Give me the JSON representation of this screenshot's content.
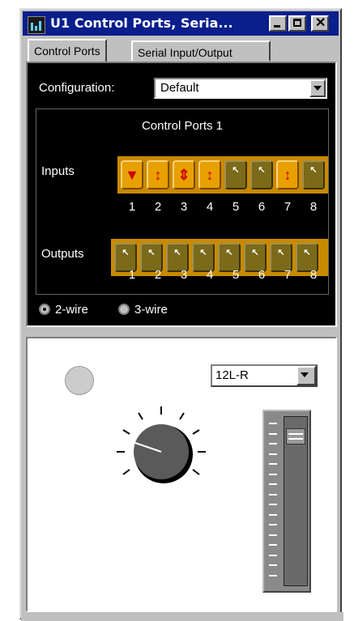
{
  "window": {
    "title": "U1 Control Ports, Seria...",
    "icon": "app-icon",
    "controls": [
      "minimize-icon",
      "maximize-icon",
      "close-icon"
    ]
  },
  "tabs": [
    {
      "label": "Control Ports",
      "active": true
    },
    {
      "label": "Serial Input/Output",
      "active": false
    }
  ],
  "configuration": {
    "label": "Configuration:",
    "value": "Default"
  },
  "ports": {
    "title": "Control Ports 1",
    "inputs_label": "Inputs",
    "outputs_label": "Outputs",
    "input_numbers": [
      "1",
      "2",
      "3",
      "4",
      "5",
      "6",
      "7",
      "8"
    ],
    "output_numbers": [
      "1",
      "2",
      "3",
      "4",
      "5",
      "6",
      "7",
      "8"
    ],
    "input_states": [
      "bell-arrow",
      "up-down-arrow",
      "triple-arrow",
      "up-down-arrow",
      "off",
      "off",
      "up-down-arrow",
      "off"
    ],
    "output_states": [
      "off",
      "off",
      "off",
      "off",
      "off",
      "off",
      "off",
      "off"
    ]
  },
  "wiring": {
    "options": [
      "2-wire",
      "3-wire"
    ],
    "selected": "2-wire"
  },
  "channel_select": {
    "value": "12L-R"
  },
  "fader": {
    "level": 0.93
  },
  "knob": {
    "value": 0.15
  },
  "colors": {
    "active_port": "#e8a000",
    "off_port": "#7a6a1a",
    "titlebar": "#0a1e8c"
  }
}
